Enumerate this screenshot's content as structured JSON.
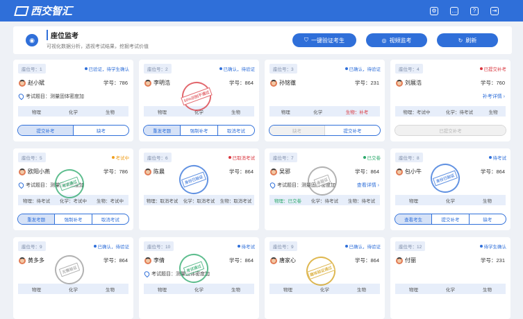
{
  "app": {
    "title": "西交智汇"
  },
  "header": {
    "title": "座位监考",
    "subtitle": "可视化数据分析，透视考试结果，挖掘考试价值",
    "btn_verify": "一键验证考生",
    "btn_video": "视频监考",
    "btn_refresh": "刷新"
  },
  "cards": [
    {
      "seat": "座位号：1",
      "status": "已验证，待学生确认",
      "status_color": "#2f6fd9",
      "name": "赵小斌",
      "sid": "学号：786",
      "exam": "考试题目：测量固体密度加",
      "link": "",
      "subjects": [
        "物理",
        "化学",
        "生物"
      ],
      "actions": [
        "提交补考",
        "缺考"
      ],
      "primary": 0,
      "stamp": ""
    },
    {
      "seat": "座位号：2",
      "status": "已确认，待验证",
      "status_color": "#2f6fd9",
      "name": "李明浩",
      "sid": "学号：864",
      "exam": "",
      "link": "",
      "subjects": [
        "物理",
        "化学",
        "生物"
      ],
      "actions": [
        "重发考题",
        "强制补考",
        "取消考试"
      ],
      "primary": 0,
      "stamp": "50%识别不通过",
      "stamp_color": "#d9363e"
    },
    {
      "seat": "座位号：3",
      "status": "已确认，待验证",
      "status_color": "#2f6fd9",
      "name": "孙铭徹",
      "sid": "学号：231",
      "exam": "",
      "link": "",
      "subjects": [
        "物理",
        "化学",
        "生物：补考"
      ],
      "actions": [
        "缺考",
        "提交补考"
      ],
      "primary": -1,
      "disabled": [
        0
      ],
      "stamp": ""
    },
    {
      "seat": "座位号：4",
      "status": "已提交补考",
      "status_color": "#d9363e",
      "name": "刘展浩",
      "sid": "学号：760",
      "exam": "",
      "link": "补考详情 ›",
      "subjects": [
        "物理：考试中",
        "化学：待考试",
        "生物"
      ],
      "actions": [
        "已提交补考"
      ],
      "primary": -1,
      "disabled": [
        0
      ],
      "stamp": ""
    },
    {
      "seat": "座位号：5",
      "status": "考试中",
      "status_color": "#f0a020",
      "name": "欧阳小燕",
      "sid": "学号：786",
      "exam": "考试题目：测量固体密度加",
      "link": "",
      "subjects": [
        "物理：待考试",
        "化学：考试中",
        "生物：考试中"
      ],
      "actions": [
        "重发考题",
        "强制补考",
        "取消考试"
      ],
      "primary": 0,
      "stamp": "考试通过",
      "stamp_color": "#2aa86a"
    },
    {
      "seat": "座位号：6",
      "status": "已取消考试",
      "status_color": "#d9363e",
      "name": "陈晨",
      "sid": "学号：864",
      "exam": "",
      "link": "",
      "subjects": [
        "物理：取消考试",
        "化学：取消考试",
        "生物：取消考试"
      ],
      "actions": [],
      "primary": -1,
      "stamp": "身份已验证",
      "stamp_color": "#2f6fd9"
    },
    {
      "seat": "座位号：7",
      "status": "已交卷",
      "status_color": "#2aa86a",
      "name": "吴邪",
      "sid": "学号：864",
      "exam": "考试题目：测量固体密度加",
      "link": "查看详情 ›",
      "subjects": [
        "物理：已交卷",
        "化学：待考试",
        "生物：待考试"
      ],
      "actions": [],
      "primary": -1,
      "stamp": "未验证",
      "stamp_color": "#9a9a9a"
    },
    {
      "seat": "座位号：8",
      "status": "待考试",
      "status_color": "#2f6fd9",
      "name": "包小牛",
      "sid": "学号：864",
      "exam": "",
      "link": "",
      "subjects": [
        "物理",
        "化学",
        "生物"
      ],
      "actions": [
        "查看考生",
        "提交补考",
        "缺考"
      ],
      "primary": 0,
      "stamp": "身份已验证",
      "stamp_color": "#2f6fd9"
    },
    {
      "seat": "座位号：9",
      "status": "已确认，待验证",
      "status_color": "#2f6fd9",
      "name": "黄多多",
      "sid": "学号：864",
      "exam": "",
      "link": "",
      "subjects": [
        "物理",
        "化学",
        "生物"
      ],
      "actions": [],
      "primary": -1,
      "stamp": "无需验证",
      "stamp_color": "#9a9a9a"
    },
    {
      "seat": "座位号：10",
      "status": "待考试",
      "status_color": "#2f6fd9",
      "name": "李倩",
      "sid": "学号：864",
      "exam": "考试题目：测量固体密度加",
      "link": "",
      "subjects": [
        "物理",
        "化学",
        "生物"
      ],
      "actions": [],
      "primary": -1,
      "stamp": "考试通过",
      "stamp_color": "#2aa86a"
    },
    {
      "seat": "座位号：9",
      "status": "已确认，待验证",
      "status_color": "#2f6fd9",
      "name": "唐家心",
      "sid": "学号：864",
      "exam": "",
      "link": "",
      "subjects": [
        "物理",
        "化学",
        "生物"
      ],
      "actions": [],
      "primary": -1,
      "stamp": "趣味验证通过",
      "stamp_color": "#d4a017"
    },
    {
      "seat": "座位号：12",
      "status": "待学生确认",
      "status_color": "#2f6fd9",
      "name": "付丽",
      "sid": "学号：231",
      "exam": "",
      "link": "",
      "subjects": [
        "物理",
        "化学",
        "生物"
      ],
      "actions": [],
      "primary": -1,
      "stamp": ""
    }
  ]
}
